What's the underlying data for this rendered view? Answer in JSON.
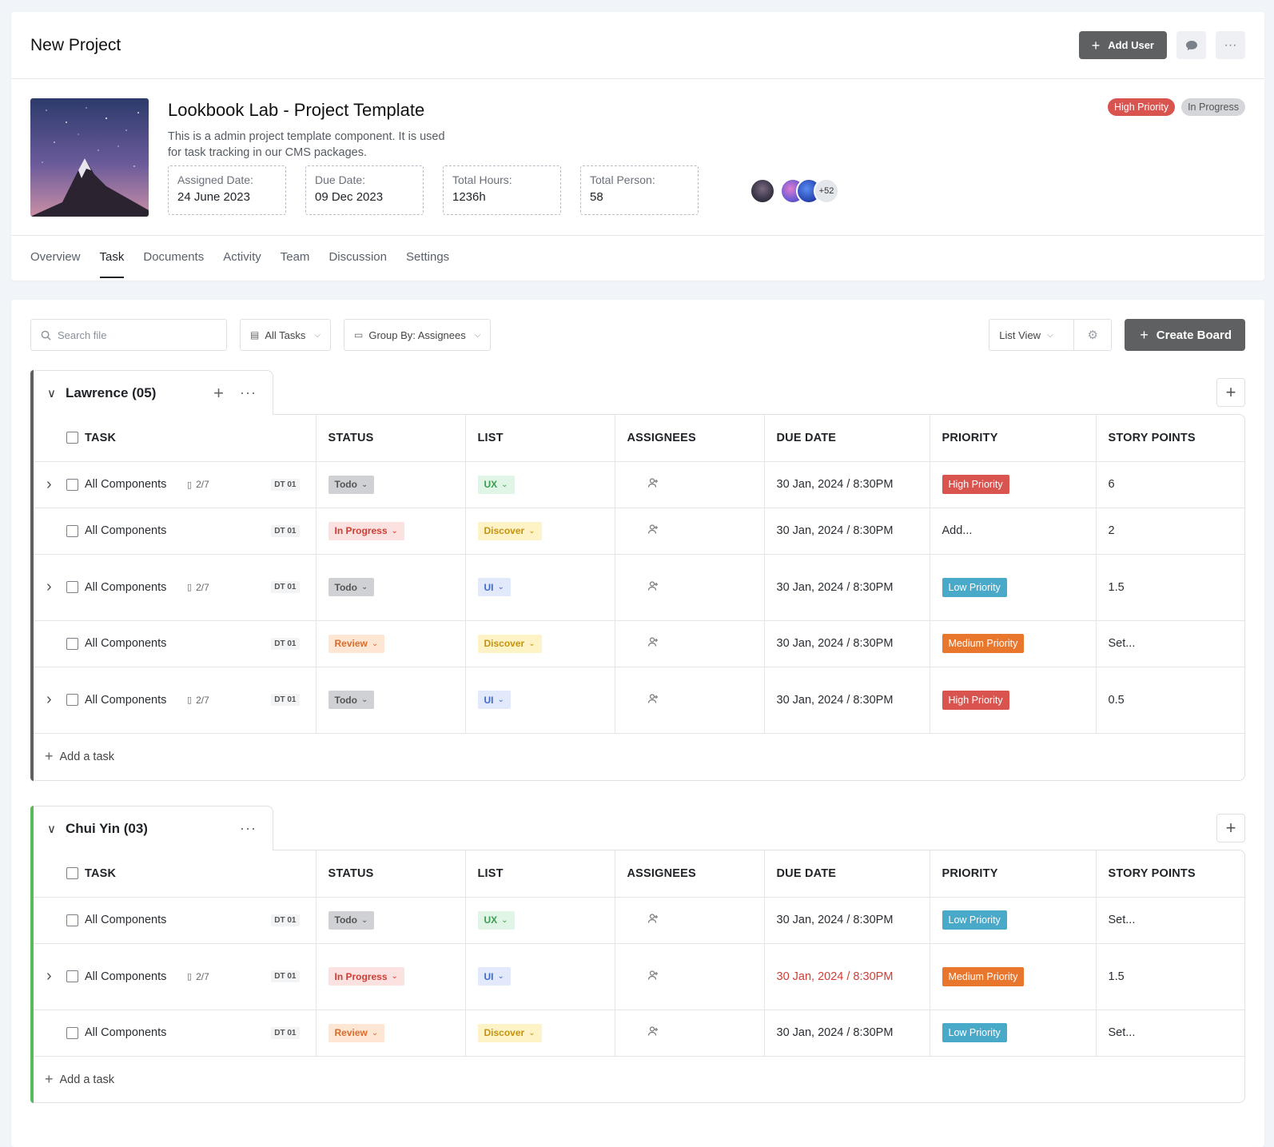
{
  "header": {
    "title": "New Project",
    "add_user_label": "Add User"
  },
  "project": {
    "name": "Lookbook Lab - Project Template",
    "description": "This is a admin project template component. It is used for task tracking in our CMS packages.",
    "stats": [
      {
        "label": "Assigned Date:",
        "value": "24 June 2023"
      },
      {
        "label": "Due Date:",
        "value": "09 Dec 2023"
      },
      {
        "label": "Total Hours:",
        "value": "1236h"
      },
      {
        "label": "Total Person:",
        "value": "58"
      }
    ],
    "avatars_more": "+52",
    "tags": {
      "priority": "High Priority",
      "status": "In Progress"
    }
  },
  "tabs": [
    "Overview",
    "Task",
    "Documents",
    "Activity",
    "Team",
    "Discussion",
    "Settings"
  ],
  "active_tab": "Task",
  "toolbar": {
    "search_placeholder": "Search file",
    "filter_label": "All Tasks",
    "group_label": "Group By: Assignees",
    "view_label": "List View",
    "create_label": "Create Board"
  },
  "columns": [
    "TASK",
    "STATUS",
    "LIST",
    "ASSIGNEES",
    "DUE DATE",
    "PRIORITY",
    "STORY POINTS"
  ],
  "add_task_label": "Add a task",
  "groups": [
    {
      "name": "Lawrence (05)",
      "accent": "#5f6061",
      "rows": [
        {
          "expand": true,
          "task": "All Components",
          "sub": "2/7",
          "code": "DT 01",
          "status": "Todo",
          "list": "UX",
          "due": "30 Jan, 2024 / 8:30PM",
          "priority": "High Priority",
          "points": "6"
        },
        {
          "expand": false,
          "task": "All Components",
          "sub": "",
          "code": "DT 01",
          "status": "In Progress",
          "list": "Discover",
          "due": "30 Jan, 2024 / 8:30PM",
          "priority": "Add...",
          "points": "2"
        },
        {
          "expand": true,
          "task": "All Components",
          "sub": "2/7",
          "code": "DT 01",
          "status": "Todo",
          "list": "UI",
          "due": "30 Jan, 2024 / 8:30PM",
          "priority": "Low Priority",
          "points": "1.5"
        },
        {
          "expand": false,
          "task": "All Components",
          "sub": "",
          "code": "DT 01",
          "status": "Review",
          "list": "Discover",
          "due": "30 Jan, 2024 / 8:30PM",
          "priority": "Medium Priority",
          "points": "Set..."
        },
        {
          "expand": true,
          "task": "All Components",
          "sub": "2/7",
          "code": "DT 01",
          "status": "Todo",
          "list": "UI",
          "due": "30 Jan, 2024 / 8:30PM",
          "priority": "High Priority",
          "points": "0.5"
        }
      ]
    },
    {
      "name": "Chui Yin (03)",
      "accent": "#5cb85c",
      "rows": [
        {
          "expand": false,
          "task": "All Components",
          "sub": "",
          "code": "DT 01",
          "status": "Todo",
          "list": "UX",
          "due": "30 Jan, 2024 / 8:30PM",
          "priority": "Low Priority",
          "points": "Set..."
        },
        {
          "expand": true,
          "task": "All Components",
          "sub": "2/7",
          "code": "DT 01",
          "status": "In Progress",
          "list": "UI",
          "due": "30 Jan, 2024 / 8:30PM",
          "due_overdue": true,
          "priority": "Medium Priority",
          "points": "1.5"
        },
        {
          "expand": false,
          "task": "All Components",
          "sub": "",
          "code": "DT 01",
          "status": "Review",
          "list": "Discover",
          "due": "30 Jan, 2024 / 8:30PM",
          "priority": "Low Priority",
          "points": "Set..."
        }
      ]
    }
  ]
}
